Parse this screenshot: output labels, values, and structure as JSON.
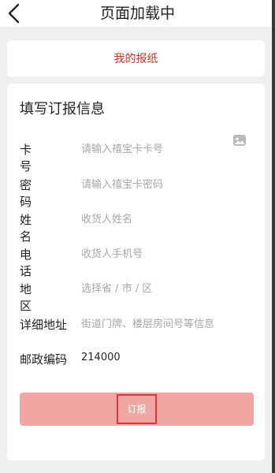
{
  "header": {
    "title": "页面加载中"
  },
  "newspaper": {
    "label": "我的报纸"
  },
  "form": {
    "title": "填写订报信息",
    "card_no": {
      "label": "卡号",
      "placeholder": "请输入禧宝卡卡号"
    },
    "password": {
      "label": "密码",
      "placeholder": "请输入禧宝卡密码"
    },
    "name": {
      "label": "姓名",
      "placeholder": "收货人姓名"
    },
    "phone": {
      "label": "电话",
      "placeholder": "收货人手机号"
    },
    "region": {
      "label": "地区",
      "placeholder": "选择省 / 市 / 区"
    },
    "address": {
      "label": "详细地址",
      "placeholder": "街道门牌、楼层房间号等信息"
    },
    "postal": {
      "label": "邮政编码",
      "value": "214000"
    },
    "submit_label": "订报"
  },
  "icons": {
    "back": "chevron-left-icon",
    "scan": "image-scan-icon"
  }
}
